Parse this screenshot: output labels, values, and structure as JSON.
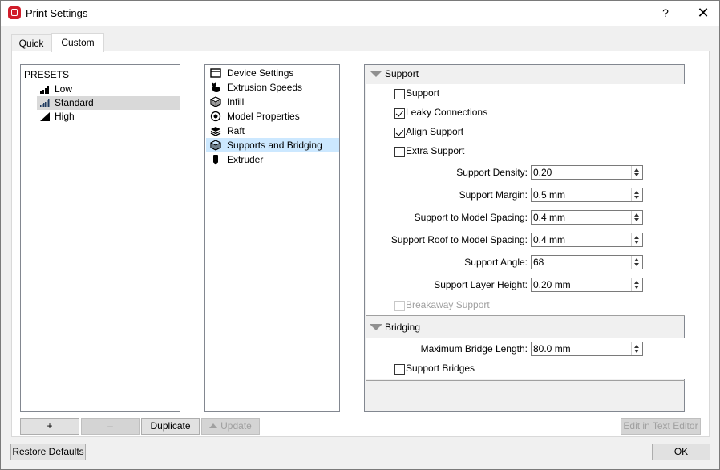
{
  "window": {
    "title": "Print Settings",
    "help": "?",
    "close": "✕"
  },
  "tabs": [
    {
      "label": "Quick"
    },
    {
      "label": "Custom"
    }
  ],
  "presets": {
    "title": "PRESETS",
    "items": [
      {
        "label": "Low"
      },
      {
        "label": "Standard"
      },
      {
        "label": "High"
      }
    ],
    "selected": "Standard"
  },
  "categories": {
    "items": [
      {
        "label": "Device Settings",
        "icon": "device-icon"
      },
      {
        "label": "Extrusion Speeds",
        "icon": "rabbit-icon"
      },
      {
        "label": "Infill",
        "icon": "infill-cube-icon"
      },
      {
        "label": "Model Properties",
        "icon": "model-icon"
      },
      {
        "label": "Raft",
        "icon": "raft-layers-icon"
      },
      {
        "label": "Supports and Bridging",
        "icon": "supports-cube-icon"
      },
      {
        "label": "Extruder",
        "icon": "extruder-icon"
      }
    ],
    "selected": "Supports and Bridging"
  },
  "support": {
    "title": "Support",
    "support_label": "Support",
    "support_checked": false,
    "leaky_label": "Leaky Connections",
    "leaky_checked": true,
    "align_label": "Align Support",
    "align_checked": true,
    "extra_label": "Extra Support",
    "extra_checked": false,
    "fields": [
      {
        "label": "Support Density:",
        "value": "0.20"
      },
      {
        "label": "Support Margin:",
        "value": "0.5 mm"
      },
      {
        "label": "Support to Model Spacing:",
        "value": "0.4 mm"
      },
      {
        "label": "Support Roof to Model Spacing:",
        "value": "0.4 mm"
      },
      {
        "label": "Support Angle:",
        "value": "68"
      },
      {
        "label": "Support Layer Height:",
        "value": "0.20 mm"
      }
    ],
    "breakaway_label": "Breakaway Support",
    "breakaway_checked": false,
    "breakaway_enabled": false
  },
  "bridging": {
    "title": "Bridging",
    "max_bridge_label": "Maximum Bridge Length:",
    "max_bridge_value": "80.0 mm",
    "support_bridges_label": "Support Bridges",
    "support_bridges_checked": false
  },
  "buttons": {
    "add": "+",
    "remove": "–",
    "duplicate": "Duplicate",
    "update": "Update",
    "edit_text": "Edit in Text Editor",
    "restore": "Restore Defaults",
    "ok": "OK"
  },
  "colors": {
    "selection_blue": "#cce8ff",
    "selection_gray": "#d9d9d9",
    "app_icon_red": "#d11d2a"
  }
}
